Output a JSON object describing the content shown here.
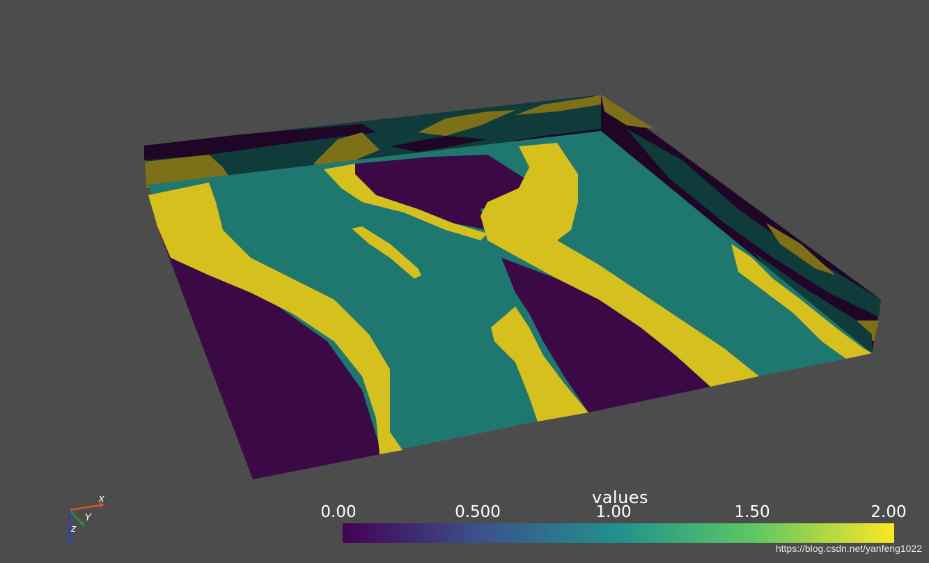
{
  "scene": {
    "description_colors": {
      "background": "#4c4c4c",
      "purple": "#3b0a46",
      "teal": "#1f786f",
      "yellow": "#d6c01e",
      "purple_dark": "#1f0626",
      "teal_dark": "#0f3b3a",
      "yellow_dark": "#7d7018"
    }
  },
  "colorbar": {
    "title": "values",
    "ticks": [
      "0.00",
      "0.500",
      "1.00",
      "1.50",
      "2.00"
    ],
    "colormap": [
      "#440154",
      "#3b528b",
      "#21918c",
      "#5ec962",
      "#fde725"
    ],
    "range": [
      0,
      2
    ]
  },
  "axes": {
    "x_label": "x",
    "y_label": "Y",
    "z_label": "z"
  },
  "watermark": "https://blog.csdn.net/yanfeng1022"
}
